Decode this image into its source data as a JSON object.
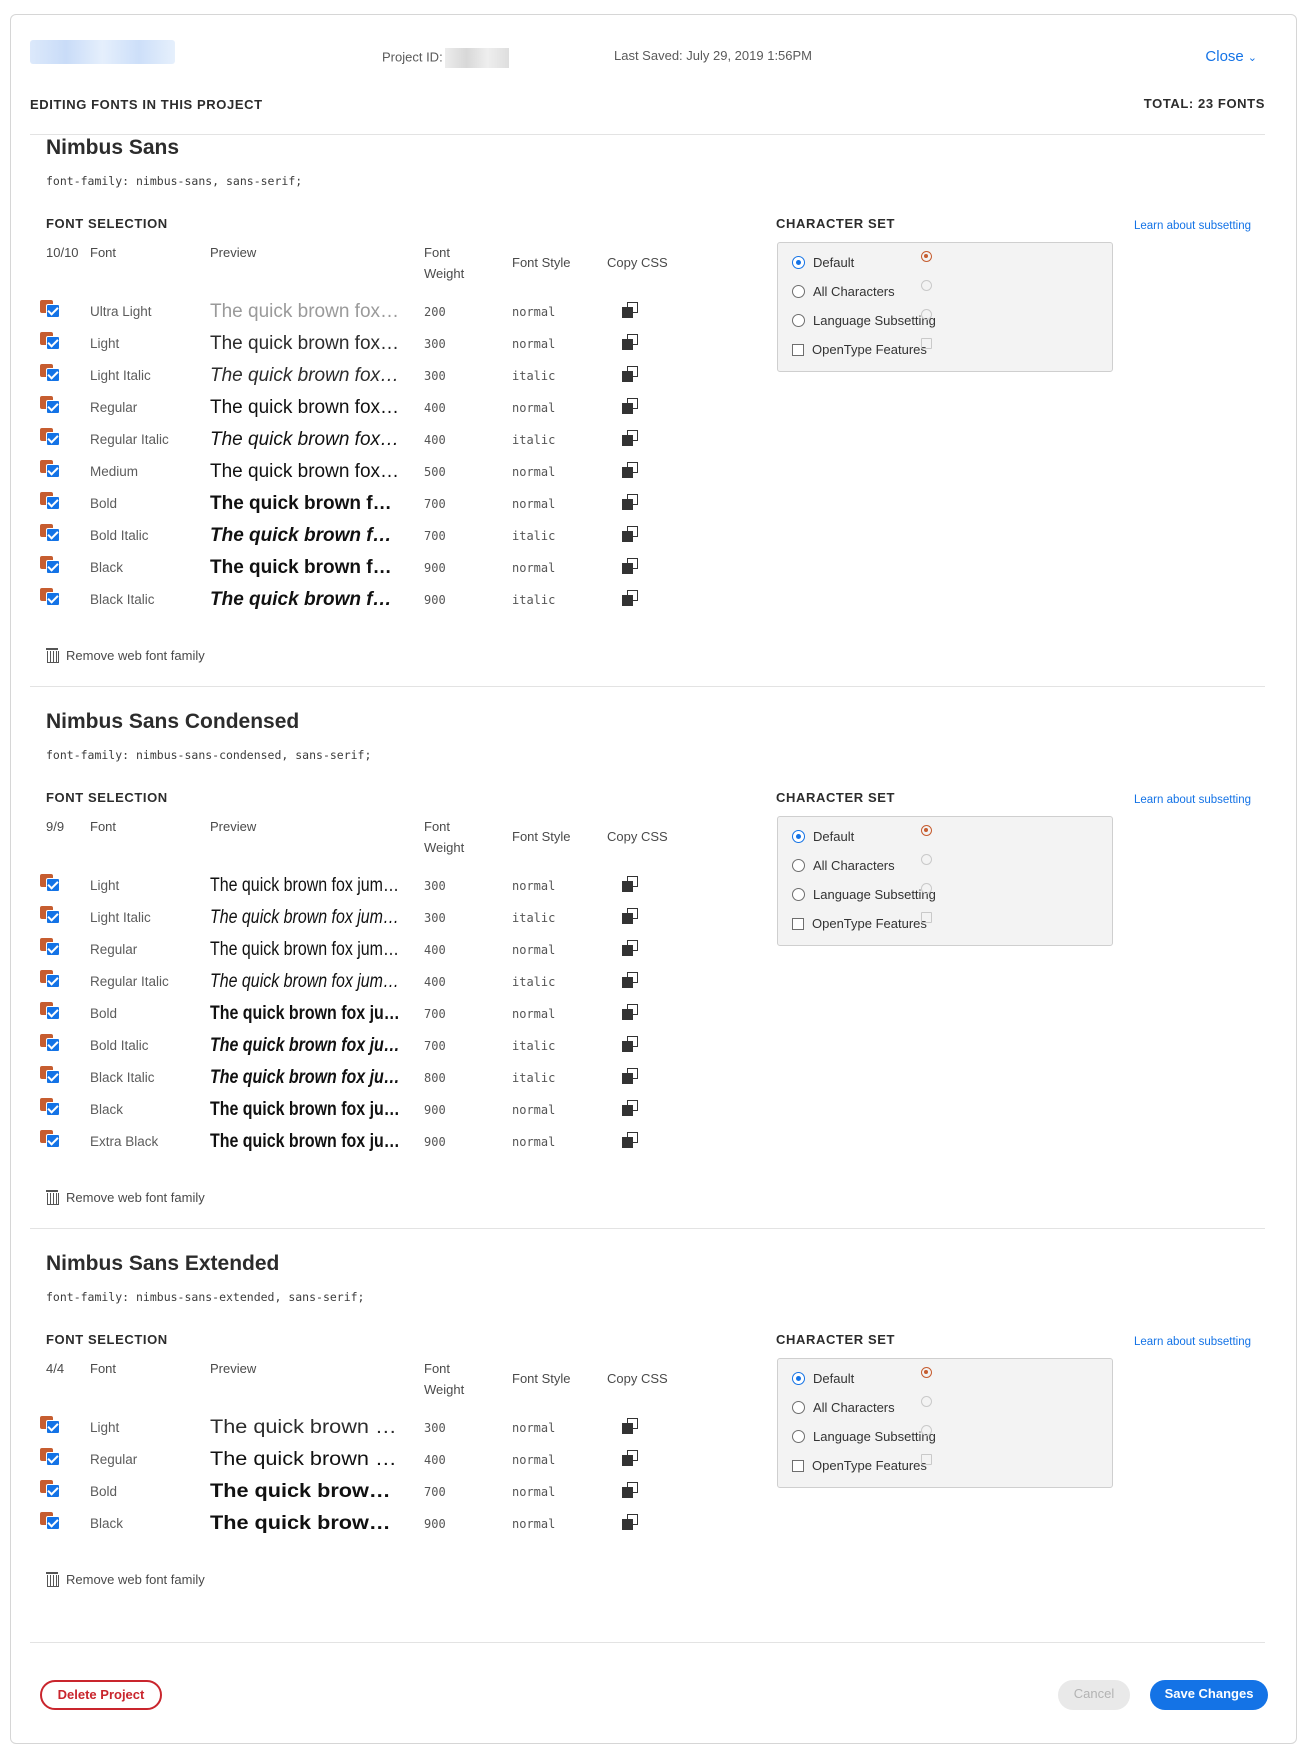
{
  "header": {
    "project_id_label": "Project ID:",
    "last_saved": "Last Saved: July 29, 2019 1:56PM",
    "close_label": "Close"
  },
  "topbar": {
    "title": "EDITING FONTS IN THIS PROJECT",
    "total": "TOTAL: 23 FONTS"
  },
  "labels": {
    "font_selection": "FONT SELECTION",
    "col_font": "Font",
    "col_preview": "Preview",
    "col_weight_1": "Font",
    "col_weight_2": "Weight",
    "col_style": "Font Style",
    "col_copy": "Copy CSS",
    "character_set": "CHARACTER SET",
    "learn_subsetting": "Learn about subsetting",
    "remove_family": "Remove web font family",
    "cs_default": "Default",
    "cs_all": "All Characters",
    "cs_language": "Language Subsetting",
    "cs_opentype": "OpenType Features"
  },
  "families": [
    {
      "name": "Nimbus Sans",
      "css": "font-family: nimbus-sans, sans-serif;",
      "count": "10/10",
      "variant": "regular",
      "character_set": "Default",
      "fonts": [
        {
          "name": "Ultra Light",
          "preview": "The quick brown fox jumps over the lazy dog",
          "weight": "200",
          "style": "normal"
        },
        {
          "name": "Light",
          "preview": "The quick brown fox jumps over the lazy dog",
          "weight": "300",
          "style": "normal"
        },
        {
          "name": "Light Italic",
          "preview": "The quick brown fox jumps over the lazy dog",
          "weight": "300",
          "style": "italic"
        },
        {
          "name": "Regular",
          "preview": "The quick brown fox jumps over the lazy dog",
          "weight": "400",
          "style": "normal"
        },
        {
          "name": "Regular Italic",
          "preview": "The quick brown fox jumps over the lazy dog",
          "weight": "400",
          "style": "italic"
        },
        {
          "name": "Medium",
          "preview": "The quick brown fox jumps over the lazy dog",
          "weight": "500",
          "style": "normal"
        },
        {
          "name": "Bold",
          "preview": "The quick brown fox jumps over the lazy dog",
          "weight": "700",
          "style": "normal"
        },
        {
          "name": "Bold Italic",
          "preview": "The quick brown fox jumps over the lazy dog",
          "weight": "700",
          "style": "italic"
        },
        {
          "name": "Black",
          "preview": "The quick brown fox jumps over the lazy dog",
          "weight": "900",
          "style": "normal"
        },
        {
          "name": "Black Italic",
          "preview": "The quick brown fox jumps over the lazy dog",
          "weight": "900",
          "style": "italic"
        }
      ]
    },
    {
      "name": "Nimbus Sans Condensed",
      "css": "font-family: nimbus-sans-condensed, sans-serif;",
      "count": "9/9",
      "variant": "condensed",
      "character_set": "Default",
      "fonts": [
        {
          "name": "Light",
          "preview": "The quick brown fox jumps over the lazy dog",
          "weight": "300",
          "style": "normal"
        },
        {
          "name": "Light Italic",
          "preview": "The quick brown fox jumps over the lazy dog",
          "weight": "300",
          "style": "italic"
        },
        {
          "name": "Regular",
          "preview": "The quick brown fox jumps over the lazy dog",
          "weight": "400",
          "style": "normal"
        },
        {
          "name": "Regular Italic",
          "preview": "The quick brown fox jumps over the lazy dog",
          "weight": "400",
          "style": "italic"
        },
        {
          "name": "Bold",
          "preview": "The quick brown fox jumps over the lazy dog",
          "weight": "700",
          "style": "normal"
        },
        {
          "name": "Bold Italic",
          "preview": "The quick brown fox jumps over the lazy dog",
          "weight": "700",
          "style": "italic"
        },
        {
          "name": "Black Italic",
          "preview": "The quick brown fox jumps over the lazy dog",
          "weight": "800",
          "style": "italic"
        },
        {
          "name": "Black",
          "preview": "The quick brown fox jumps over the lazy dog",
          "weight": "900",
          "style": "normal"
        },
        {
          "name": "Extra Black",
          "preview": "The quick brown fox jumps over the lazy dog",
          "weight": "900",
          "style": "normal"
        }
      ]
    },
    {
      "name": "Nimbus Sans Extended",
      "css": "font-family: nimbus-sans-extended, sans-serif;",
      "count": "4/4",
      "variant": "extended",
      "character_set": "Default",
      "fonts": [
        {
          "name": "Light",
          "preview": "The quick brown fox jumps over the lazy dog",
          "weight": "300",
          "style": "normal"
        },
        {
          "name": "Regular",
          "preview": "The quick brown fox jumps over the lazy dog",
          "weight": "400",
          "style": "normal"
        },
        {
          "name": "Bold",
          "preview": "The quick brown fox jumps over the lazy dog",
          "weight": "700",
          "style": "normal"
        },
        {
          "name": "Black",
          "preview": "The quick brown fox jumps over the lazy dog",
          "weight": "900",
          "style": "normal"
        }
      ]
    }
  ],
  "footer": {
    "delete_label": "Delete Project",
    "cancel_label": "Cancel",
    "save_label": "Save Changes"
  },
  "colors": {
    "accent": "#1473e6",
    "danger": "#c9252d",
    "checkbox_back": "#c65d30"
  }
}
